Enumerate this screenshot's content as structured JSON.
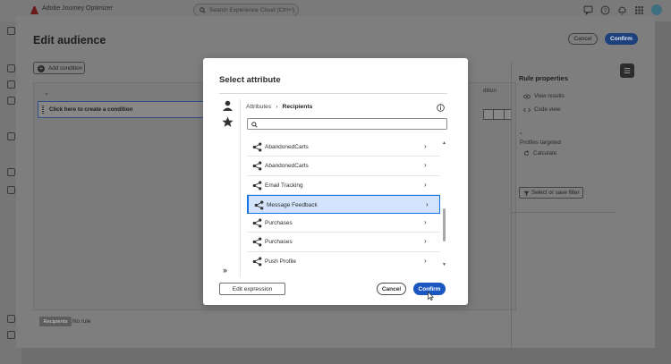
{
  "app": {
    "title": "Adobe Journey Optimizer",
    "search_placeholder": "Search Experience Cloud (Ctrl+/)"
  },
  "editor": {
    "title": "Edit audience",
    "cancel_label": "Cancel",
    "confirm_label": "Confirm",
    "add_condition_label": "Add condition",
    "condition_placeholder": "Click here to create a condition",
    "addition_text": "dition",
    "recipients_tag": "Recipients",
    "no_rule": "No rule"
  },
  "rule_properties": {
    "title": "Rule properties",
    "view_results": "View results",
    "code_view": "Code view",
    "dash": "-",
    "profiles_targeted": "Profiles targeted",
    "calculate": "Calculate",
    "select_or_save_filter": "Select or save filter"
  },
  "modal": {
    "title": "Select attribute",
    "breadcrumb": [
      "Attributes",
      "Recipients"
    ],
    "search_placeholder": "",
    "items": [
      {
        "label": "AbandonedCarts",
        "selected": false
      },
      {
        "label": "AbandonedCarts",
        "selected": false
      },
      {
        "label": "Email Tracking",
        "selected": false
      },
      {
        "label": "Message Feedback",
        "selected": true
      },
      {
        "label": "Purchases",
        "selected": false
      },
      {
        "label": "Purchases",
        "selected": false
      },
      {
        "label": "Push Profile",
        "selected": false
      }
    ],
    "edit_expression_label": "Edit expression",
    "cancel_label": "Cancel",
    "confirm_label": "Confirm"
  },
  "colors": {
    "accent": "#1a57c2",
    "selected_row_bg": "#d3e3fb",
    "selected_row_border": "#1473e6",
    "overlay_dim": "#6e6e6e"
  },
  "icons": {
    "item_icon": "share-link-icon",
    "side_top": "person-icon",
    "side_second": "star-icon"
  }
}
